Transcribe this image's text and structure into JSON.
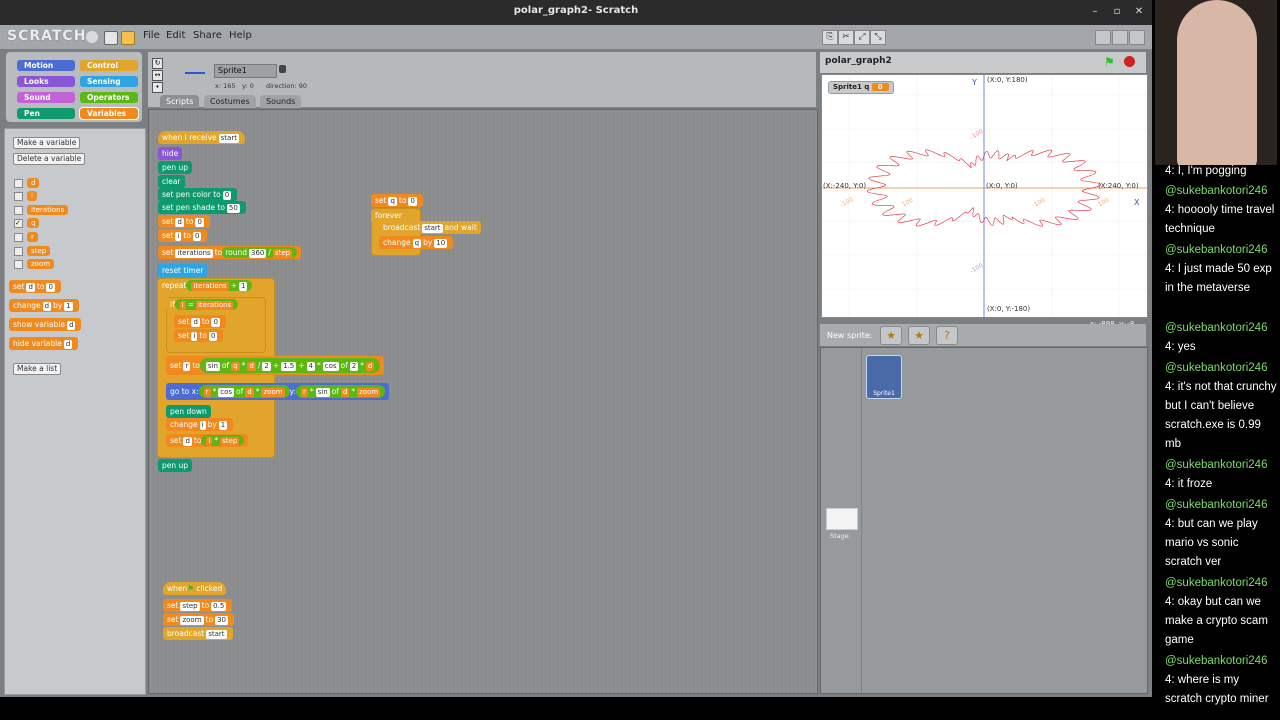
{
  "window": {
    "title": "polar_graph2- Scratch"
  },
  "menu": {
    "logo": "SCRATCH",
    "file": "File",
    "edit": "Edit",
    "share": "Share",
    "help": "Help"
  },
  "categories": [
    "Motion",
    "Control",
    "Looks",
    "Sensing",
    "Sound",
    "Operators",
    "Pen",
    "Variables"
  ],
  "palette": {
    "make_variable": "Make a variable",
    "delete_variable": "Delete a variable",
    "variables": [
      "d",
      "i",
      "iterations",
      "q",
      "r",
      "step",
      "zoom"
    ],
    "checked": "q",
    "blocks": [
      "set",
      "to",
      "change",
      "by",
      "show variable",
      "hide variable"
    ],
    "block_var": "d",
    "block_set_value": "0",
    "block_change_value": "1",
    "make_list": "Make a list"
  },
  "sprite": {
    "name": "Sprite1",
    "x": "x: 165",
    "y": "y: 0",
    "direction": "direction: 90"
  },
  "tabs": [
    "Scripts",
    "Costumes",
    "Sounds"
  ],
  "scripts": {
    "s1": [
      "when I receive",
      "start",
      "hide",
      "pen up",
      "clear",
      "set pen color to",
      "0",
      "set pen shade to",
      "50",
      "set",
      "d",
      "to",
      "0",
      "i",
      "iterations",
      "round",
      "360",
      "/",
      "step",
      "reset timer",
      "repeat",
      "iterations",
      "+",
      "1",
      "if",
      "i",
      "=",
      "iterations",
      "d",
      "i",
      "r",
      "sin",
      "of",
      "q",
      "*",
      "d",
      "/",
      "2",
      "+",
      "1.5",
      "4",
      "cos",
      "of",
      "2",
      "*",
      "d",
      "go to x:",
      "r",
      "*",
      "cos",
      "of",
      "d",
      "*",
      "zoom",
      "y:",
      "r",
      "*",
      "sin",
      "of",
      "d",
      "*",
      "zoom",
      "pen down",
      "change",
      "i",
      "by",
      "1",
      "set",
      "d",
      "to",
      "i",
      "*",
      "step",
      "pen up"
    ],
    "s2": [
      "set",
      "q",
      "to",
      "0",
      "forever",
      "broadcast",
      "start",
      "and wait",
      "change",
      "q",
      "by",
      "10"
    ],
    "s3": [
      "when",
      "clicked",
      "set",
      "step",
      "to",
      "0.5",
      "set",
      "zoom",
      "to",
      "30",
      "broadcast",
      "start"
    ]
  },
  "stage": {
    "title": "polar_graph2",
    "monitor_label": "Sprite1 q",
    "monitor_value": "0",
    "axis_y": "Y",
    "axis_x": "X",
    "top_label": "(X:0, Y:180)",
    "bottom_label": "(X:0, Y:-180)",
    "left_label": "(X:-240, Y:0)",
    "right_label": "(X:240, Y:0)",
    "center_label": "(X:0, Y:0)",
    "tick_labels": [
      "-100",
      "100",
      "100",
      "-100",
      "100",
      "-100"
    ]
  },
  "mouse": {
    "x": "x: -898",
    "y": "y: -8"
  },
  "sprite_library": {
    "new_sprite": "New sprite:",
    "sprite_name": "Sprite1",
    "stage_label": "Stage"
  },
  "chat": [
    {
      "user": "",
      "text": "4: I, I'm pogging"
    },
    {
      "user": "@sukebankotori246",
      "text": "4: hooooly time travel technique"
    },
    {
      "user": "@sukebankotori246",
      "text": "4: I just made 50 exp in the metaverse"
    },
    {
      "user": "@sukebankotori246",
      "text": "4: yes"
    },
    {
      "user": "@sukebankotori246",
      "text": "4: it's not that crunchy but I can't believe scratch.exe is 0.99 mb"
    },
    {
      "user": "@sukebankotori246",
      "text": "4: it froze"
    },
    {
      "user": "@sukebankotori246",
      "text": "4: but can we play mario vs sonic scratch ver"
    },
    {
      "user": "@sukebankotori246",
      "text": "4: okay but can we make a crypto scam game"
    },
    {
      "user": "@sukebankotori246",
      "text": "4: where is my scratch crypto miner"
    }
  ],
  "colors": {
    "looks": "#8a55d7",
    "control": "#e0a52a",
    "pen": "#0e9a6c",
    "variables": "#f08a1f",
    "operators": "#5cb712",
    "motion": "#4a6cd4",
    "sensing": "#2ca5e2"
  }
}
